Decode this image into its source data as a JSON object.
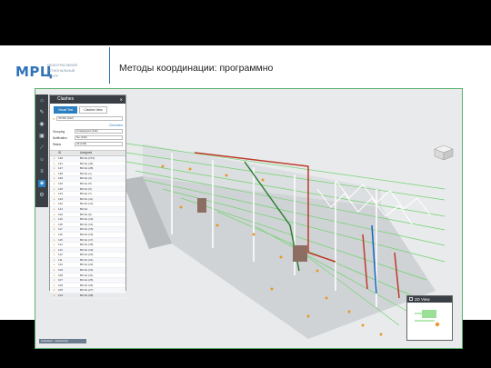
{
  "slide": {
    "logo": {
      "mark": "МРЦ",
      "subtitle_lines": [
        "МЕЖОТРАСЛЕВОЙ",
        "РЕГИОНАЛЬНЫЙ",
        "ЦЕНТР"
      ]
    },
    "title": "Методы координации: программно"
  },
  "clashes_panel": {
    "title": "Clashes",
    "tabs": [
      "Visual Test",
      "Clashes View"
    ],
    "selected_test": "VP-ВК (132)",
    "overview_label": "Overview",
    "fields": [
      {
        "label": "Grouping",
        "value": "Unassigned (132)"
      },
      {
        "label": "Notification",
        "value": "No (132)"
      },
      {
        "label": "Status",
        "value": "All (132)"
      }
    ],
    "columns": [
      "",
      "ID",
      "Assigned"
    ],
    "rows": [
      {
        "id": "130",
        "assigned": "ВК list (274)"
      },
      {
        "id": "131",
        "assigned": "ВК list (44)"
      },
      {
        "id": "127",
        "assigned": "ВК list (28)"
      },
      {
        "id": "128",
        "assigned": "ВК list (1)"
      },
      {
        "id": "129",
        "assigned": "ВК list (4)"
      },
      {
        "id": "126",
        "assigned": "ВК list (5)"
      },
      {
        "id": "125",
        "assigned": "ВК list (6)"
      },
      {
        "id": "124",
        "assigned": "ВК list (7)"
      },
      {
        "id": "123",
        "assigned": "ВК list (11)"
      },
      {
        "id": "122",
        "assigned": "ВК list (12)"
      },
      {
        "id": "121",
        "assigned": "ВК list"
      },
      {
        "id": "120",
        "assigned": "ВК list (6)"
      },
      {
        "id": "119",
        "assigned": "ВК list (13)"
      },
      {
        "id": "118",
        "assigned": "ВК list (14)"
      },
      {
        "id": "117",
        "assigned": "ВК list (15)"
      },
      {
        "id": "116",
        "assigned": "ВК list (16)"
      },
      {
        "id": "115",
        "assigned": "ВК list (17)"
      },
      {
        "id": "114",
        "assigned": "ВК list (18)"
      },
      {
        "id": "113",
        "assigned": "ВК list (19)"
      },
      {
        "id": "112",
        "assigned": "ВК list (20)"
      },
      {
        "id": "111",
        "assigned": "ВК list (21)"
      },
      {
        "id": "110",
        "assigned": "ВК list (22)"
      },
      {
        "id": "109",
        "assigned": "ВК list (23)"
      },
      {
        "id": "108",
        "assigned": "ВК list (24)"
      },
      {
        "id": "107",
        "assigned": "ВК list (25)"
      },
      {
        "id": "106",
        "assigned": "ВК list (26)"
      },
      {
        "id": "105",
        "assigned": "ВК list (27)"
      },
      {
        "id": "104",
        "assigned": "ВК list (28)"
      }
    ]
  },
  "status_bar": {
    "text": "Autodesk · navisworks"
  },
  "minimap": {
    "title": "2D View"
  },
  "toolbar": {
    "icons": [
      "home-icon",
      "pencil-icon",
      "eye-icon",
      "camera-icon",
      "ruler-icon",
      "sun-icon",
      "layers-icon",
      "clash-icon",
      "settings-icon"
    ]
  },
  "colors": {
    "accent": "#2f74b8",
    "frame": "#58b26b",
    "warning": "#e79a2a",
    "toolbar": "#3a3f46"
  }
}
